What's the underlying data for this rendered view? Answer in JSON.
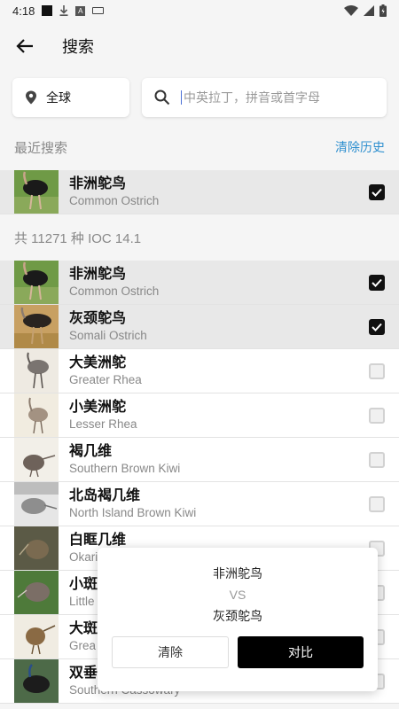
{
  "status": {
    "time": "4:18"
  },
  "header": {
    "title": "搜索"
  },
  "search": {
    "region": "全球",
    "placeholder": "中英拉丁，拼音或首字母"
  },
  "recent": {
    "label": "最近搜索",
    "clear_label": "清除历史",
    "items": [
      {
        "cn": "非洲鸵鸟",
        "en": "Common Ostrich",
        "checked": true
      }
    ]
  },
  "catalog": {
    "count_label": "共 11271 种 IOC 14.1",
    "items": [
      {
        "cn": "非洲鸵鸟",
        "en": "Common Ostrich",
        "checked": true
      },
      {
        "cn": "灰颈鸵鸟",
        "en": "Somali Ostrich",
        "checked": true
      },
      {
        "cn": "大美洲鸵",
        "en": "Greater Rhea",
        "checked": false
      },
      {
        "cn": "小美洲鸵",
        "en": "Lesser Rhea",
        "checked": false
      },
      {
        "cn": "褐几维",
        "en": "Southern Brown Kiwi",
        "checked": false
      },
      {
        "cn": "北岛褐几维",
        "en": "North Island Brown Kiwi",
        "checked": false
      },
      {
        "cn": "白眶几维",
        "en": "Okari",
        "checked": false
      },
      {
        "cn": "小斑",
        "en": "Little",
        "checked": false
      },
      {
        "cn": "大斑",
        "en": "Grea",
        "checked": false
      },
      {
        "cn": "双垂",
        "en": "Southern Cassowary",
        "checked": false
      }
    ]
  },
  "compare": {
    "bird1": "非洲鸵鸟",
    "vs": "VS",
    "bird2": "灰颈鸵鸟",
    "clear_label": "清除",
    "compare_label": "对比"
  }
}
